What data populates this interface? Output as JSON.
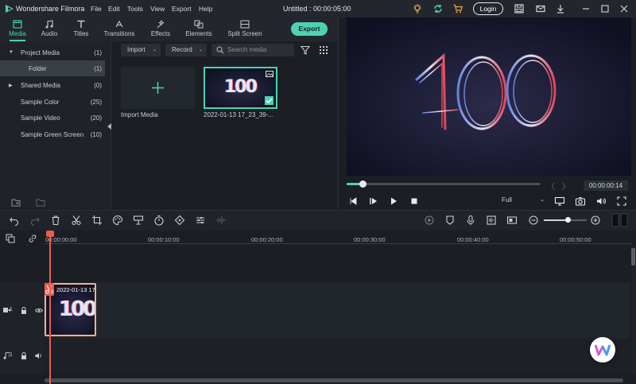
{
  "app": {
    "name": "Wondershare Filmora",
    "menu": [
      "File",
      "Edit",
      "Tools",
      "View",
      "Export",
      "Help"
    ],
    "doc_title": "Untitled : 00:00:05:00",
    "login_label": "Login"
  },
  "tabs": [
    {
      "label": "Media",
      "icon": "media-icon"
    },
    {
      "label": "Audio",
      "icon": "audio-icon"
    },
    {
      "label": "Titles",
      "icon": "titles-icon"
    },
    {
      "label": "Transitions",
      "icon": "transitions-icon"
    },
    {
      "label": "Effects",
      "icon": "effects-icon"
    },
    {
      "label": "Elements",
      "icon": "elements-icon"
    },
    {
      "label": "Split Screen",
      "icon": "split-screen-icon"
    }
  ],
  "export_label": "Export",
  "library": {
    "items": [
      {
        "name": "Project Media",
        "count": "(1)"
      },
      {
        "name": "Folder",
        "count": "(1)"
      },
      {
        "name": "Shared Media",
        "count": "(0)"
      },
      {
        "name": "Sample Color",
        "count": "(25)"
      },
      {
        "name": "Sample Video",
        "count": "(20)"
      },
      {
        "name": "Sample Green Screen",
        "count": "(10)"
      }
    ]
  },
  "media": {
    "import_label": "Import",
    "record_label": "Record",
    "search_placeholder": "Search media",
    "import_tile_label": "Import Media",
    "clip_label": "2022-01-13 17_23_39-...",
    "thumb_text": "100"
  },
  "preview": {
    "big_text": "100",
    "timecode": "00:00:00:14",
    "quality": "Full",
    "progress": 0.08
  },
  "timeline": {
    "ruler": [
      "00:00:00:00",
      "00:00:10:00",
      "00:00:20:00",
      "00:00:30:00",
      "00:00:40:00",
      "00:00:50:00"
    ],
    "clip_label": "2022-01-13 17",
    "video_track": "1",
    "audio_track": "1",
    "zoom_level": 0.55
  },
  "colors": {
    "accent": "#4ed2b3",
    "playhead": "#ef5a4d",
    "clip_border": "#f2b38a"
  }
}
